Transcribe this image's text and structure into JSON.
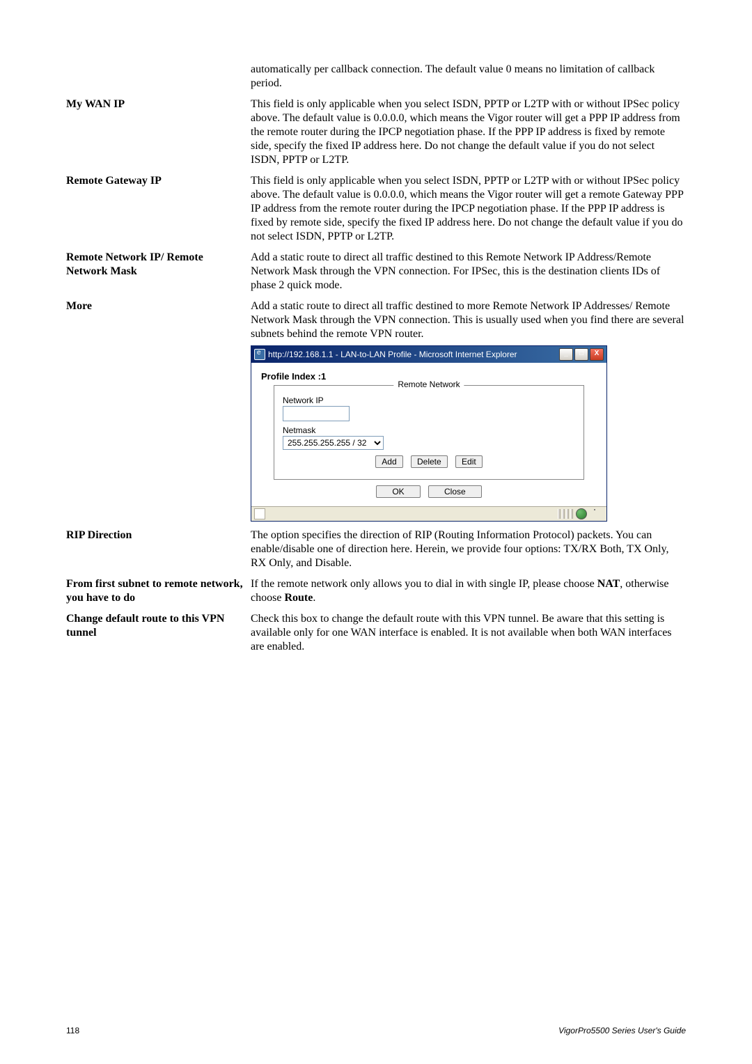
{
  "intro": {
    "continuation": "automatically per callback connection. The default value 0 means no limitation of callback period."
  },
  "rows": [
    {
      "label": "My WAN IP",
      "desc": "This field is only applicable when you select ISDN, PPTP or L2TP with or without IPSec policy above. The default value is 0.0.0.0, which means the Vigor router will get a PPP IP address from the remote router during the IPCP negotiation phase. If the PPP IP address is fixed by remote side, specify the fixed IP address here. Do not change the default value if you do not select ISDN, PPTP or L2TP."
    },
    {
      "label": "Remote Gateway IP",
      "desc": "This field is only applicable when you select ISDN, PPTP or L2TP with or without IPSec policy above. The default value is 0.0.0.0, which means the Vigor router will get a remote Gateway PPP IP address from the remote router during the IPCP negotiation phase. If the PPP IP address is fixed by remote side, specify the fixed IP address here. Do not change the default value if you do not select ISDN, PPTP or L2TP."
    },
    {
      "label": "Remote Network IP/ Remote Network Mask",
      "desc": "Add a static route to direct all traffic destined to this Remote Network IP Address/Remote Network Mask through the VPN connection. For IPSec, this is the destination clients IDs of phase 2 quick mode."
    },
    {
      "label": "More",
      "desc": "Add a static route to direct all traffic destined to more Remote Network IP Addresses/ Remote Network Mask through the VPN connection. This is usually used when you find there are several subnets behind the remote VPN router."
    }
  ],
  "dialog": {
    "title": "http://192.168.1.1 - LAN-to-LAN Profile - Microsoft Internet Explorer",
    "profile_index": "Profile Index :1",
    "legend": "Remote Network",
    "network_ip_label": "Network IP",
    "netmask_label": "Netmask",
    "netmask_value": "255.255.255.255 / 32",
    "buttons": {
      "add": "Add",
      "delete": "Delete",
      "edit": "Edit",
      "ok": "OK",
      "close": "Close"
    },
    "win": {
      "min": "_",
      "max": "□",
      "close": "X"
    }
  },
  "rows2": [
    {
      "label": "RIP Direction",
      "desc": "The option specifies the direction of RIP (Routing Information Protocol) packets. You can enable/disable one of direction here. Herein, we provide four options: TX/RX Both, TX Only, RX Only, and Disable."
    },
    {
      "label": "From first subnet to remote network, you have to do",
      "desc_html": true,
      "pre": "If the remote network only allows you to dial in with single IP, please choose ",
      "bold1": "NAT",
      "mid": ", otherwise choose ",
      "bold2": "Route",
      "suffix": "."
    },
    {
      "label": "Change default route to this VPN tunnel",
      "desc": "Check this box to change the default route with this VPN tunnel. Be aware that this setting is available only for one WAN interface is enabled. It is not available when both WAN interfaces are enabled."
    }
  ],
  "footer": {
    "page": "118",
    "right": "VigorPro5500  Series  User's  Guide"
  }
}
